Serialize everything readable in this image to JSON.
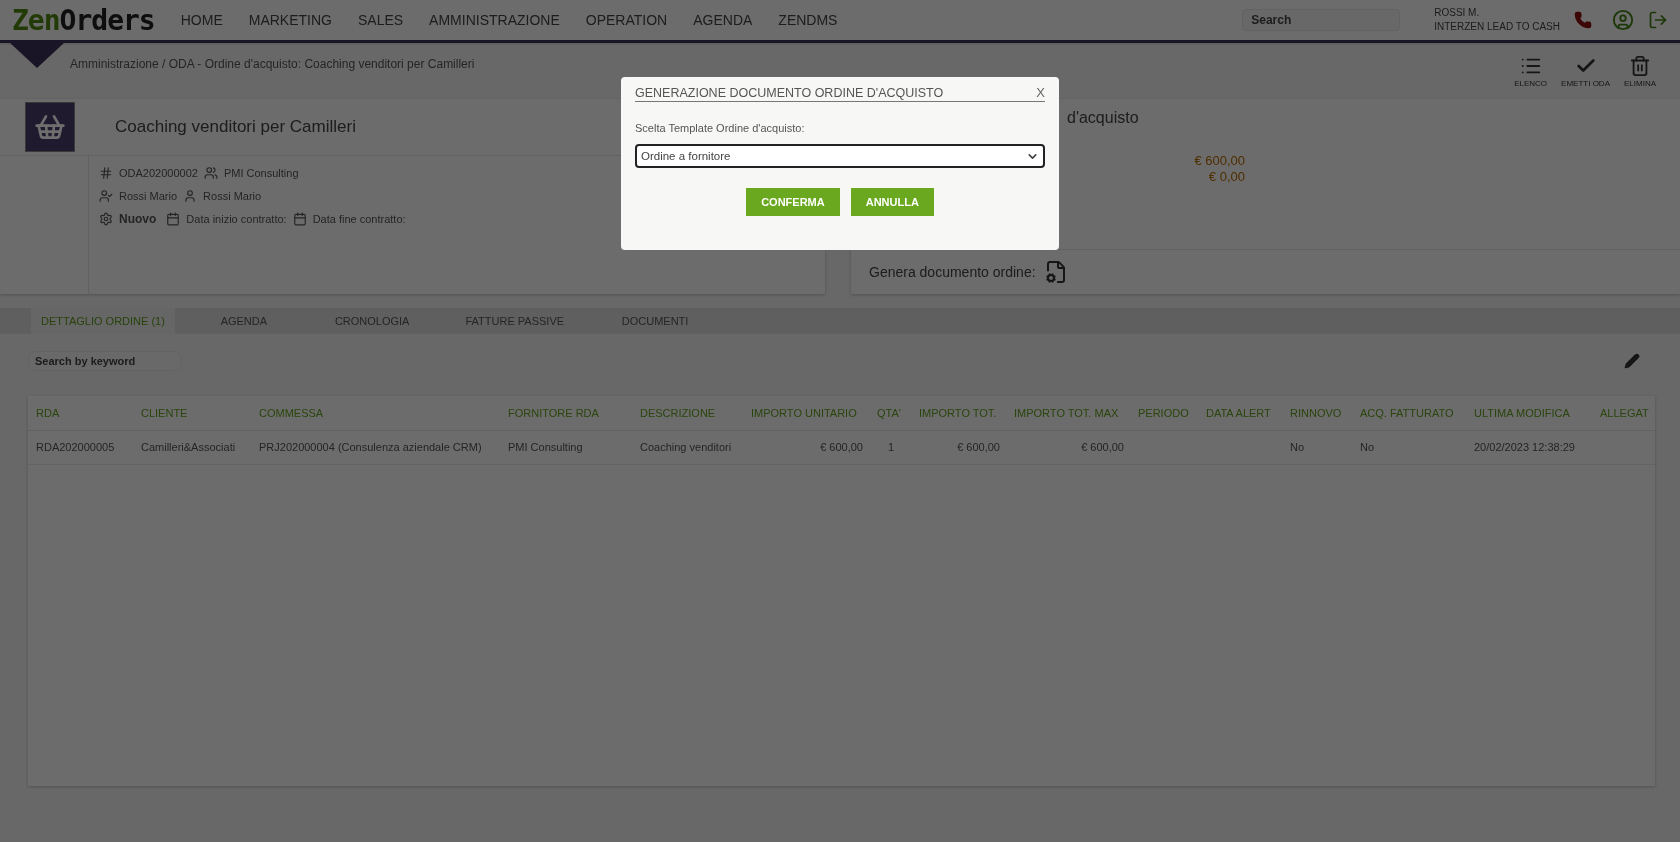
{
  "logo": {
    "part_1": "Zen",
    "part_2": "Orders"
  },
  "nav": [
    "HOME",
    "MARKETING",
    "SALES",
    "AMMINISTRAZIONE",
    "OPERATION",
    "AGENDA",
    "ZENDMS"
  ],
  "search": {
    "placeholder": "Search"
  },
  "user": {
    "name": "ROSSI M.",
    "company": "INTERZEN LEAD TO CASH"
  },
  "breadcrumb": "Amministrazione / ODA - Ordine d'acquisto: Coaching venditori per Camilleri",
  "toolbar": [
    {
      "label": "ELENCO",
      "kind": "list"
    },
    {
      "label": "EMETTI ODA",
      "kind": "check"
    },
    {
      "label": "ELIMINA",
      "kind": "trash"
    }
  ],
  "order": {
    "title": "Coaching venditori per Camilleri",
    "code": "ODA202000002",
    "supplier": "PMI Consulting",
    "owner": "Rossi Mario",
    "assignee": "Rossi Mario",
    "status": "Nuovo",
    "start_label": "Data inizio contratto:",
    "end_label": "Data fine contratto:"
  },
  "summary": {
    "title": "d'acquisto",
    "amounts": [
      "€ 600,00",
      "€ 0,00"
    ],
    "generate_label": "Genera documento ordine:"
  },
  "tabs": [
    {
      "label": "DETTAGLIO ORDINE (1)",
      "selected": true
    },
    {
      "label": "AGENDA",
      "selected": false
    },
    {
      "label": "CRONOLOGIA",
      "selected": false
    },
    {
      "label": "FATTURE PASSIVE",
      "selected": false
    },
    {
      "label": "DOCUMENTI",
      "selected": false
    }
  ],
  "table_search": {
    "placeholder": "Search by keyword"
  },
  "table": {
    "columns": [
      "RDA",
      "CLIENTE",
      "COMMESSA",
      "FORNITORE RDA",
      "DESCRIZIONE",
      "IMPORTO UNITARIO",
      "QTA'",
      "IMPORTO TOT.",
      "IMPORTO TOT. MAX",
      "PERIODO",
      "DATA ALERT",
      "RINNOVO",
      "ACQ. FATTURATO",
      "ULTIMA MODIFICA",
      "ALLEGAT"
    ],
    "rows": [
      [
        "RDA202000005",
        "Camilleri&Associati",
        "PRJ202000004 (Consulenza aziendale CRM)",
        "PMI Consulting",
        "Coaching venditori",
        "€ 600,00",
        "1",
        "€ 600,00",
        "€ 600,00",
        null,
        null,
        "No",
        "No",
        "20/02/2023 12:38:29",
        null
      ]
    ]
  },
  "modal": {
    "title": "GENERAZIONE DOCUMENTO ORDINE D'ACQUISTO",
    "close": "X",
    "field_label": "Scelta Template Ordine d'acquisto:",
    "select_value": "Ordine a fornitore",
    "buttons": [
      {
        "label": "CONFERMA"
      },
      {
        "label": "ANNULLA"
      }
    ]
  }
}
